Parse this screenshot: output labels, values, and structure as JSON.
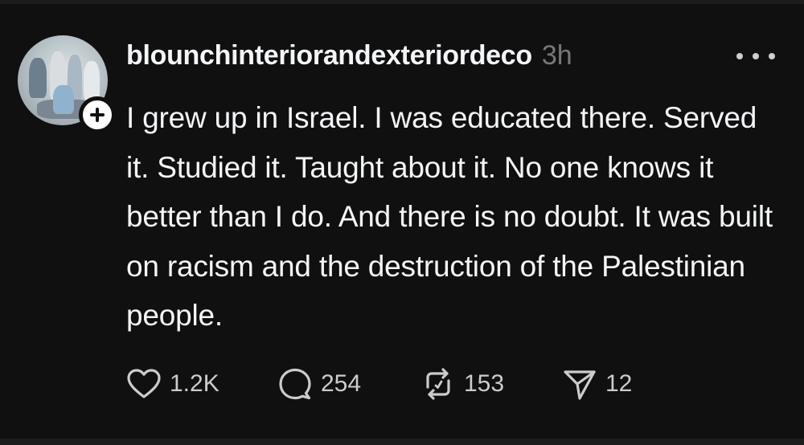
{
  "post": {
    "username": "blounchinteriorandexteriordeco",
    "time": "3h",
    "text": "I grew up in Israel. I was educated there. Served it. Studied it. Taught about it. No one knows it better than I do. And there is no doubt. It was built on racism and the destruction of the Palestinian people.",
    "avatar_icon": "profile-photo",
    "follow_icon": "plus-icon",
    "more_icon": "ellipsis-icon"
  },
  "actions": {
    "likes": "1.2K",
    "replies": "254",
    "reposts": "153",
    "shares": "12",
    "like_icon": "heart-icon",
    "reply_icon": "speech-bubble-icon",
    "repost_icon": "repost-icon",
    "share_icon": "send-icon"
  },
  "colors": {
    "background": "#101010",
    "text": "#f3f5f7",
    "muted": "#777777"
  }
}
